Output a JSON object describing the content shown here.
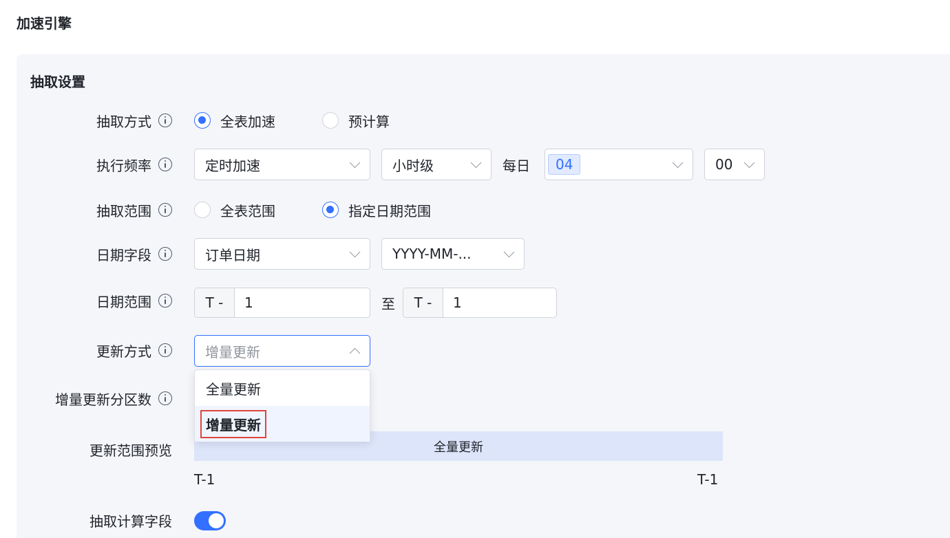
{
  "page": {
    "title": "加速引擎"
  },
  "section": {
    "title": "抽取设置"
  },
  "rows": {
    "extract_method": {
      "label": "抽取方式",
      "options": [
        "全表加速",
        "预计算"
      ],
      "selected": "全表加速"
    },
    "frequency": {
      "label": "执行频率",
      "mode": "定时加速",
      "granularity": "小时级",
      "daily_label": "每日",
      "hour": "04",
      "minute": "00"
    },
    "extract_range": {
      "label": "抽取范围",
      "options": [
        "全表范围",
        "指定日期范围"
      ],
      "selected": "指定日期范围"
    },
    "date_field": {
      "label": "日期字段",
      "field": "订单日期",
      "format": "YYYY-MM-..."
    },
    "date_range": {
      "label": "日期范围",
      "start_prefix": "T -",
      "start_value": "1",
      "separator": "至",
      "end_prefix": "T -",
      "end_value": "1"
    },
    "update_method": {
      "label": "更新方式",
      "placeholder": "增量更新",
      "options": [
        "全量更新",
        "增量更新"
      ],
      "highlighted": "增量更新"
    },
    "incremental_partitions": {
      "label": "增量更新分区数"
    },
    "update_preview": {
      "label": "更新范围预览",
      "bar_text": "全量更新",
      "start_tick": "T-1",
      "end_tick": "T-1"
    },
    "extract_calc_fields": {
      "label": "抽取计算字段",
      "enabled": true
    }
  },
  "colors": {
    "accent": "#3370ff",
    "highlight_box": "#e0443a",
    "preview_bar": "#dde5fa"
  }
}
